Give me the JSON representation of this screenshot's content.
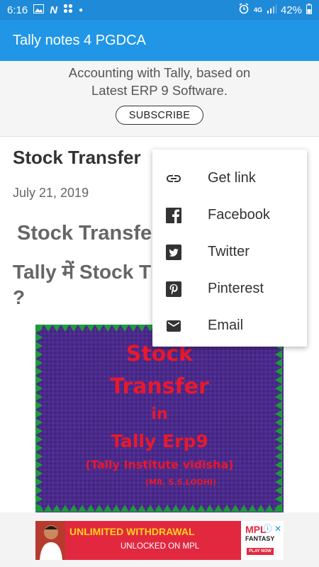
{
  "status_bar": {
    "time": "6:16",
    "network": "4G",
    "battery": "42%",
    "left_icons": [
      "gallery-icon",
      "n-app-icon",
      "apps-icon",
      "dot-icon"
    ],
    "right_icons": [
      "alarm-icon",
      "network-4g-icon",
      "signal-icon",
      "battery-icon"
    ]
  },
  "app_bar": {
    "title": "Tally notes 4 PGDCA"
  },
  "banner": {
    "line1": "Accounting with Tally, based on",
    "line2": "Latest ERP 9 Software.",
    "subscribe_label": "SUBSCRIBE"
  },
  "post": {
    "title": "Stock Transfer",
    "date": "July 21, 2019",
    "heading1": "Stock Transfe",
    "heading2_line1": "Tally में Stock T",
    "heading2_line2": "?"
  },
  "post_image": {
    "line1": "Stock",
    "line2": "Transfer",
    "line3": "in",
    "line4": "Tally Erp9",
    "line5": "(Tally Institute vidisha)",
    "line6": "(MR. S.S.LODHI)",
    "bg_color": "#4a2a8a",
    "text_color": "#e8192c",
    "border_color": "#1e9b3a"
  },
  "share_menu": {
    "items": [
      {
        "label": "Get link",
        "icon": "link-icon"
      },
      {
        "label": "Facebook",
        "icon": "facebook-icon"
      },
      {
        "label": "Twitter",
        "icon": "twitter-icon"
      },
      {
        "label": "Pinterest",
        "icon": "pinterest-icon"
      },
      {
        "label": "Email",
        "icon": "email-icon"
      }
    ]
  },
  "ad": {
    "headline": "UNLIMITED WITHDRAWAL",
    "subline": "UNLOCKED ON MPL",
    "brand_top": "MPL",
    "brand_bottom": "FANTASY",
    "cta": "PLAY NOW"
  },
  "colors": {
    "status_bar": "#1f8ad8",
    "app_bar": "#2196e6",
    "ad_red": "#e2283f",
    "ad_yellow": "#ffd21f"
  }
}
